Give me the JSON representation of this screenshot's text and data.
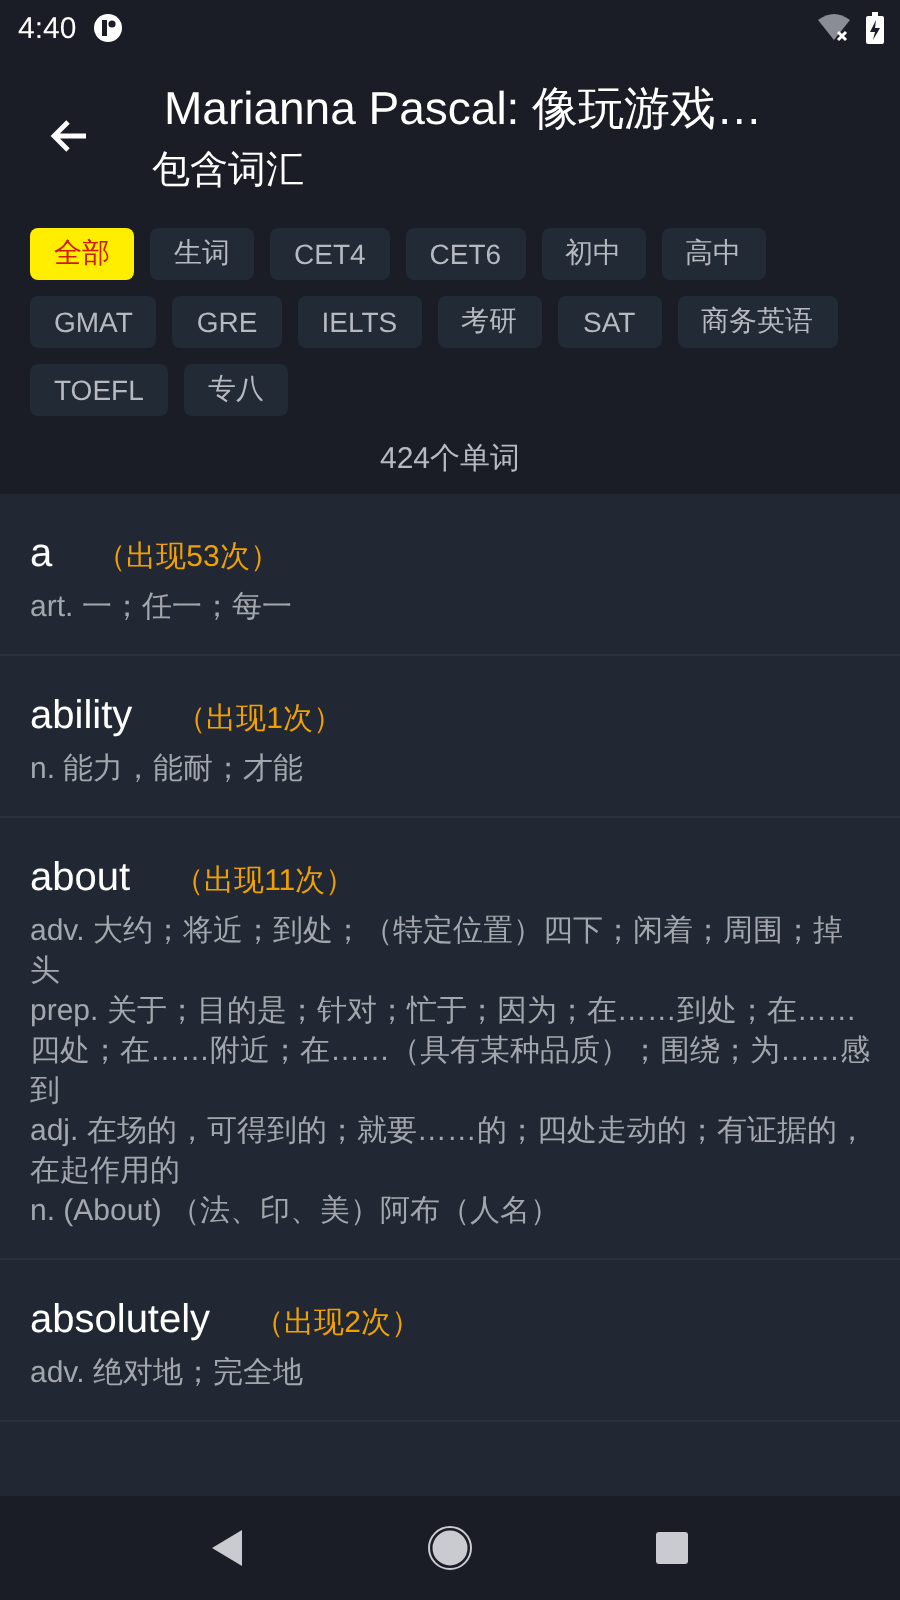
{
  "status_bar": {
    "time": "4:40"
  },
  "header": {
    "title": "Marianna Pascal: 像玩游戏…",
    "subtitle": "包含词汇"
  },
  "filters": [
    {
      "label": "全部",
      "selected": true
    },
    {
      "label": "生词",
      "selected": false
    },
    {
      "label": "CET4",
      "selected": false
    },
    {
      "label": "CET6",
      "selected": false
    },
    {
      "label": "初中",
      "selected": false
    },
    {
      "label": "高中",
      "selected": false
    },
    {
      "label": "GMAT",
      "selected": false
    },
    {
      "label": "GRE",
      "selected": false
    },
    {
      "label": "IELTS",
      "selected": false
    },
    {
      "label": "考研",
      "selected": false
    },
    {
      "label": "SAT",
      "selected": false
    },
    {
      "label": "商务英语",
      "selected": false
    },
    {
      "label": "TOEFL",
      "selected": false
    },
    {
      "label": "专八",
      "selected": false
    }
  ],
  "word_count": "424个单词",
  "words": [
    {
      "word": "a",
      "count": "（出现53次）",
      "definitions": [
        "art. 一；任一；每一"
      ]
    },
    {
      "word": "ability",
      "count": "（出现1次）",
      "definitions": [
        "n. 能力，能耐；才能"
      ]
    },
    {
      "word": "about",
      "count": "（出现11次）",
      "definitions": [
        "adv. 大约；将近；到处；（特定位置）四下；闲着；周围；掉头",
        "prep. 关于；目的是；针对；忙于；因为；在……到处；在……四处；在……附近；在……（具有某种品质）；围绕；为……感到",
        "adj. 在场的，可得到的；就要……的；四处走动的；有证据的，在起作用的",
        "n. (About) （法、印、美）阿布（人名）"
      ]
    },
    {
      "word": "absolutely",
      "count": "（出现2次）",
      "definitions": [
        "adv. 绝对地；完全地"
      ]
    }
  ]
}
